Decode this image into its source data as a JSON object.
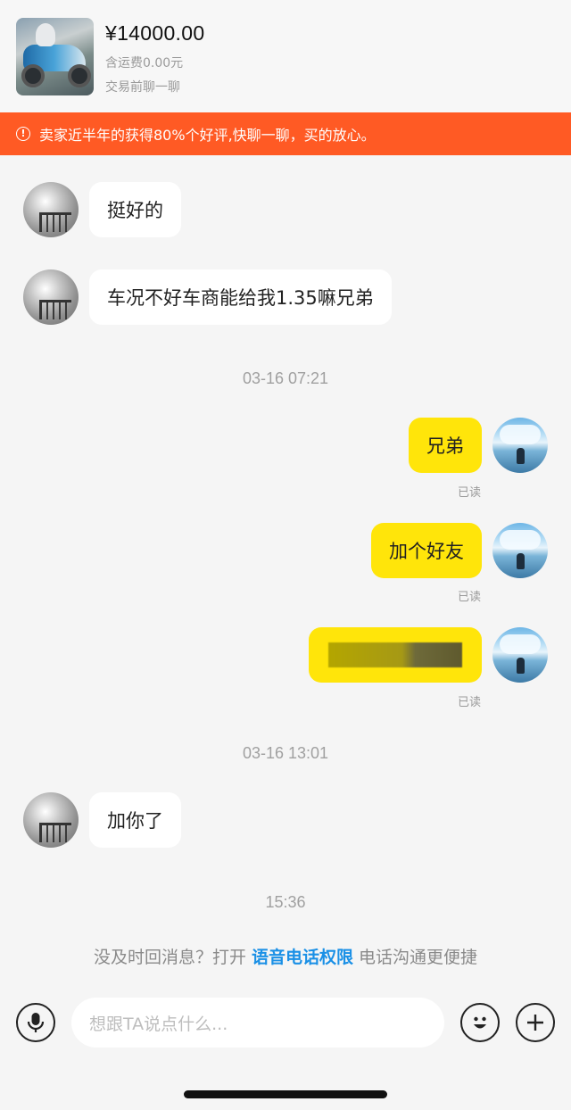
{
  "header": {
    "price": "¥14000.00",
    "shipping": "含运费0.00元",
    "pre_chat": "交易前聊一聊"
  },
  "banner": {
    "text": "卖家近半年的获得80%个好评,快聊一聊，买的放心。",
    "color": "#ff5a24"
  },
  "messages": [
    {
      "from": "seller",
      "text": "挺好的"
    },
    {
      "from": "seller",
      "text": "车况不好车商能给我1.35嘛兄弟"
    },
    {
      "time": "03-16 07:21"
    },
    {
      "from": "me",
      "text": "兄弟",
      "status": "已读"
    },
    {
      "from": "me",
      "text": "加个好友",
      "status": "已读"
    },
    {
      "from": "me",
      "text": "",
      "status": "已读",
      "redacted": true
    },
    {
      "time": "03-16 13:01"
    },
    {
      "from": "seller",
      "text": "加你了"
    },
    {
      "time": "15:36"
    }
  ],
  "permission": {
    "prefix": "没及时回消息？打开 ",
    "link": "语音电话权限",
    "suffix": " 电话沟通更便捷",
    "link_color": "#1a90e6"
  },
  "input": {
    "placeholder": "想跟TA说点什么..."
  },
  "icons": {
    "voice": "microphone-icon",
    "emoji": "emoji-icon",
    "more": "plus-icon"
  },
  "colors": {
    "bubble_out": "#ffe50a",
    "bubble_in": "#ffffff",
    "background": "#f5f5f5"
  }
}
